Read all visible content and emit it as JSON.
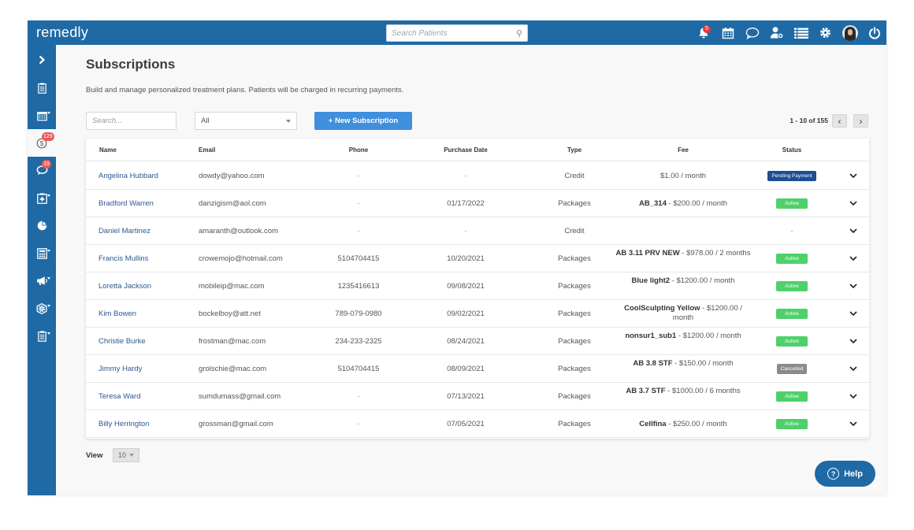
{
  "app": {
    "brand": "remedly"
  },
  "topbar": {
    "search_placeholder": "Search Patients",
    "notification_count": "5",
    "icons": [
      "bell-icon",
      "calendar-icon",
      "chat-icon",
      "user-add-icon",
      "list-icon",
      "gear-icon",
      "avatar",
      "power-icon"
    ]
  },
  "sidebar": {
    "badges": {
      "payments": "129",
      "messages": "19"
    },
    "icons": [
      "chevron-right-icon",
      "clipboard-icon",
      "calendar-icon",
      "dollar-icon",
      "chat-icon",
      "medical-kit-icon",
      "pie-chart-icon",
      "calculator-icon",
      "megaphone-icon",
      "settings-icon",
      "report-icon"
    ]
  },
  "page": {
    "title": "Subscriptions",
    "subtitle": "Build and manage personalized treatment plans. Patients will be charged in recurring payments.",
    "search_placeholder": "Search...",
    "filter_value": "All",
    "new_button": "+ New Subscription",
    "pagination": "1 - 10 of 155"
  },
  "table": {
    "headers": {
      "name": "Name",
      "email": "Email",
      "phone": "Phone",
      "purchase_date": "Purchase Date",
      "type": "Type",
      "fee": "Fee",
      "status": "Status"
    },
    "rows": [
      {
        "name": "Angelina Hubbard",
        "email": "dowdy@yahoo.com",
        "phone": "-",
        "date": "-",
        "type": "Credit",
        "fee_bold": "",
        "fee_rest": "$1.00 / month",
        "status": "Pending Payment"
      },
      {
        "name": "Bradford Warren",
        "email": "danzigism@aol.com",
        "phone": "-",
        "date": "01/17/2022",
        "type": "Packages",
        "fee_bold": "AB_314",
        "fee_rest": " - $200.00 / month",
        "status": "Active"
      },
      {
        "name": "Daniel Martinez",
        "email": "amaranth@outlook.com",
        "phone": "-",
        "date": "-",
        "type": "Credit",
        "fee_bold": "",
        "fee_rest": "",
        "status": "-"
      },
      {
        "name": "Francis Mullins",
        "email": "crowemojo@hotmail.com",
        "phone": "5104704415",
        "date": "10/20/2021",
        "type": "Packages",
        "fee_bold": "AB 3.11 PRV NEW",
        "fee_rest": " - $978.00 / 2 months",
        "status": "Active"
      },
      {
        "name": "Loretta Jackson",
        "email": "mobileip@mac.com",
        "phone": "1235416613",
        "date": "09/08/2021",
        "type": "Packages",
        "fee_bold": "Blue light2",
        "fee_rest": " - $1200.00 / month",
        "status": "Active"
      },
      {
        "name": "Kim Bowen",
        "email": "bockelboy@att.net",
        "phone": "789-079-0980",
        "date": "09/02/2021",
        "type": "Packages",
        "fee_bold": "CoolSculpting Yellow",
        "fee_rest": " - $1200.00 / month",
        "status": "Active"
      },
      {
        "name": "Christie Burke",
        "email": "frostman@mac.com",
        "phone": "234-233-2325",
        "date": "08/24/2021",
        "type": "Packages",
        "fee_bold": "nonsur1_sub1",
        "fee_rest": " - $1200.00 / month",
        "status": "Active"
      },
      {
        "name": "Jimmy Hardy",
        "email": "grolschie@mac.com",
        "phone": "5104704415",
        "date": "08/09/2021",
        "type": "Packages",
        "fee_bold": "AB 3.8 STF",
        "fee_rest": " - $150.00 / month",
        "status": "Cancelled"
      },
      {
        "name": "Teresa Ward",
        "email": "sumdumass@gmail.com",
        "phone": "-",
        "date": "07/13/2021",
        "type": "Packages",
        "fee_bold": "AB 3.7 STF",
        "fee_rest": " - $1000.00 / 6 months",
        "status": "Active"
      },
      {
        "name": "Billy Herrington",
        "email": "grossman@gmail.com",
        "phone": "-",
        "date": "07/05/2021",
        "type": "Packages",
        "fee_bold": "Cellfina",
        "fee_rest": " - $250.00 / month",
        "status": "Active"
      }
    ]
  },
  "footer": {
    "view_label": "View",
    "view_value": "10",
    "help_label": "Help"
  },
  "colors": {
    "brand": "#1f6aa5",
    "button": "#3f8fdc",
    "active": "#4fd06a",
    "pending": "#1c4d92",
    "cancelled": "#8a8a8a",
    "link": "#2b5a92"
  }
}
